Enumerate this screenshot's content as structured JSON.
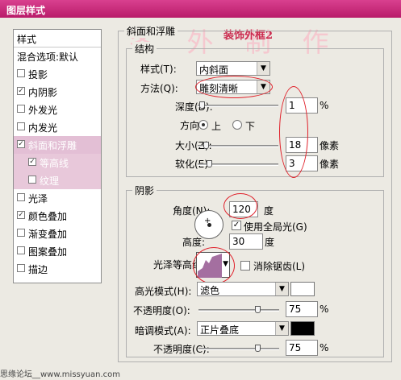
{
  "window": {
    "title": "图层样式"
  },
  "watermark": "冬  外  制  作",
  "annotation": "装饰外框2",
  "sidebar": {
    "header": "样式",
    "items": [
      {
        "label": "混合选项:默认",
        "checkbox": false,
        "checked": false,
        "selected": false
      },
      {
        "label": "投影",
        "checkbox": true,
        "checked": false
      },
      {
        "label": "内阴影",
        "checkbox": true,
        "checked": true
      },
      {
        "label": "外发光",
        "checkbox": true,
        "checked": false
      },
      {
        "label": "内发光",
        "checkbox": true,
        "checked": false
      },
      {
        "label": "斜面和浮雕",
        "checkbox": true,
        "checked": true,
        "selected": true
      },
      {
        "label": "等高线",
        "checkbox": true,
        "checked": true,
        "sub": true
      },
      {
        "label": "纹理",
        "checkbox": true,
        "checked": false,
        "sub": true
      },
      {
        "label": "光泽",
        "checkbox": true,
        "checked": false
      },
      {
        "label": "颜色叠加",
        "checkbox": true,
        "checked": true
      },
      {
        "label": "渐变叠加",
        "checkbox": true,
        "checked": false
      },
      {
        "label": "图案叠加",
        "checkbox": true,
        "checked": false
      },
      {
        "label": "描边",
        "checkbox": true,
        "checked": false
      }
    ]
  },
  "bevel": {
    "section_title": "斜面和浮雕",
    "structure": {
      "title": "结构",
      "style_label": "样式(T):",
      "style_value": "内斜面",
      "technique_label": "方法(Q):",
      "technique_value": "雕刻清晰",
      "depth_label": "深度(D):",
      "depth_value": "1",
      "depth_unit": "%",
      "depth_slider": 0.02,
      "direction_label": "方向:",
      "direction_up": "上",
      "direction_down": "下",
      "size_label": "大小(Z):",
      "size_value": "18",
      "size_unit": "像素",
      "size_slider": 0.07,
      "soften_label": "软化(E):",
      "soften_value": "3",
      "soften_unit": "像素",
      "soften_slider": 0.12
    },
    "shading": {
      "title": "阴影",
      "angle_label": "角度(N):",
      "angle_value": "120",
      "angle_unit": "度",
      "global_light_label": "使用全局光(G)",
      "altitude_label": "高度:",
      "altitude_value": "30",
      "altitude_unit": "度",
      "gloss_contour_label": "光泽等高线:",
      "anti_alias_label": "消除锯齿(L)",
      "highlight_mode_label": "高光模式(H):",
      "highlight_mode_value": "滤色",
      "highlight_color": "#ffffff",
      "highlight_opacity_label": "不透明度(O):",
      "highlight_opacity_value": "75",
      "highlight_opacity_unit": "%",
      "highlight_opacity_slider": 0.75,
      "shadow_mode_label": "暗调模式(A):",
      "shadow_mode_value": "正片叠底",
      "shadow_color": "#000000",
      "shadow_opacity_label": "不透明度(C):",
      "shadow_opacity_value": "75",
      "shadow_opacity_unit": "%",
      "shadow_opacity_slider": 0.75
    }
  },
  "footer": "思缘论坛__www.missyuan.com",
  "colors": {
    "accent": "#c41f72",
    "selection": "#e3bfd5",
    "annotation_circle": "#e0202a"
  }
}
